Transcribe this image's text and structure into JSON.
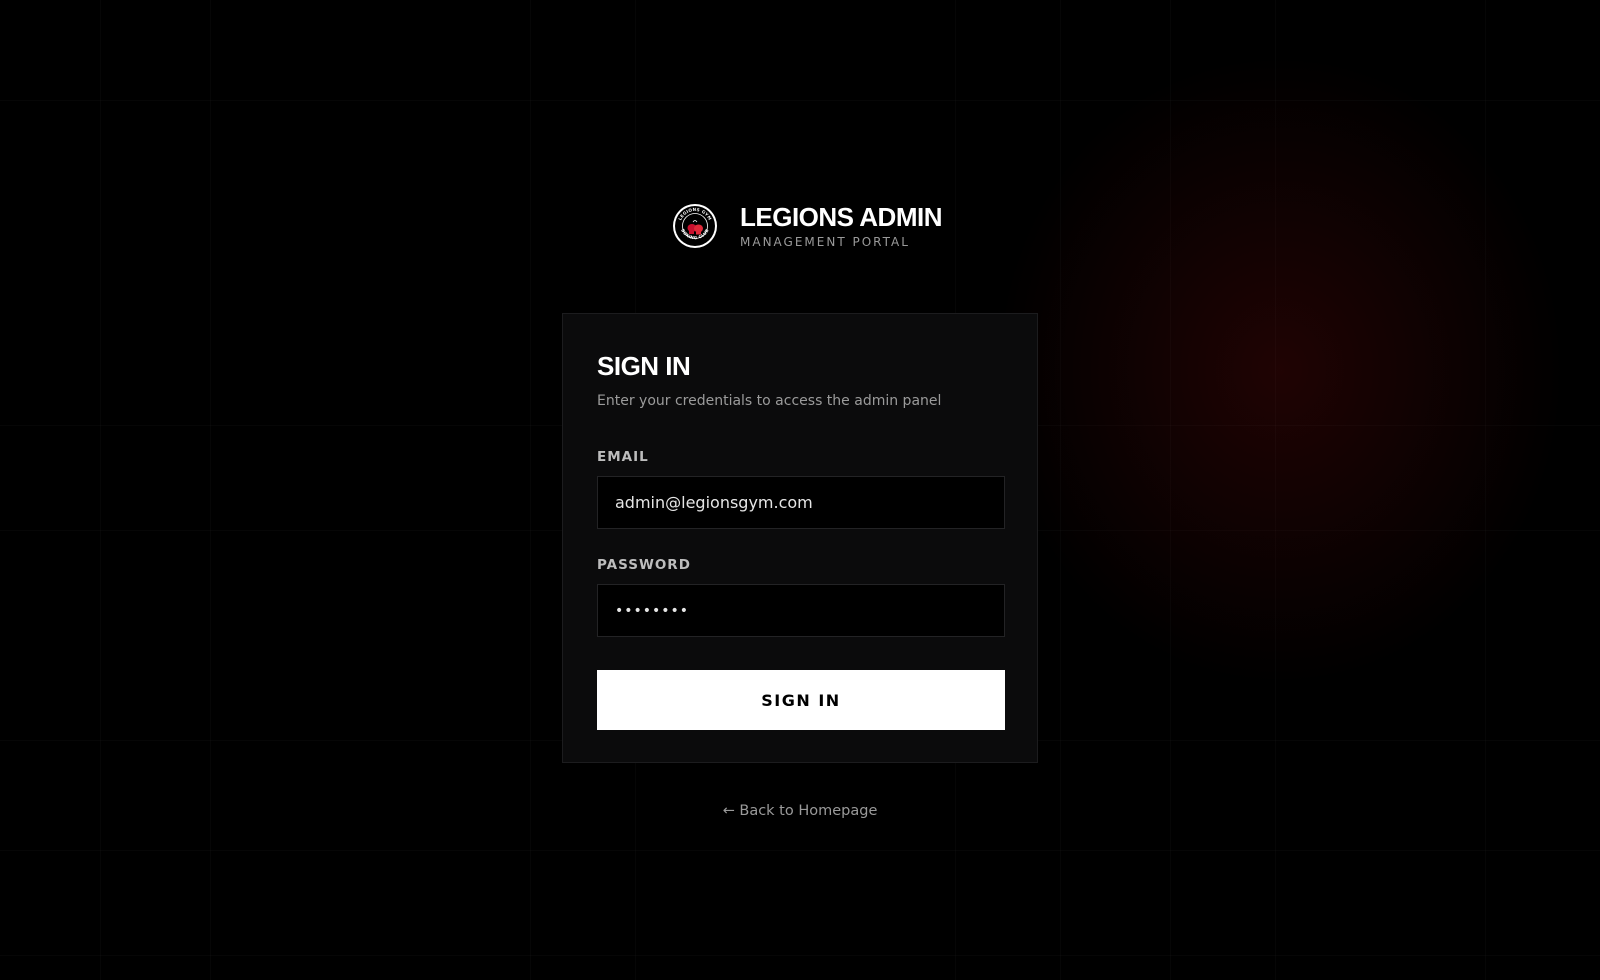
{
  "brand": {
    "title": "LEGIONS ADMIN",
    "subtitle": "MANAGEMENT PORTAL",
    "logo_icon": "boxing-club-badge-icon",
    "logo_text_top": "LEGIONS GYM",
    "logo_text_bottom": "BOXING CLUB"
  },
  "card": {
    "title": "SIGN IN",
    "subtitle": "Enter your credentials to access the admin panel"
  },
  "form": {
    "email_label": "EMAIL",
    "email_value": "admin@legionsgym.com",
    "password_label": "PASSWORD",
    "password_value": "••••••••",
    "submit_label": "SIGN IN"
  },
  "footer": {
    "back_link": "← Back to Homepage"
  },
  "colors": {
    "background": "#000000",
    "card": "#0b0b0c",
    "accent_red": "#c8102e",
    "button": "#ffffff"
  }
}
